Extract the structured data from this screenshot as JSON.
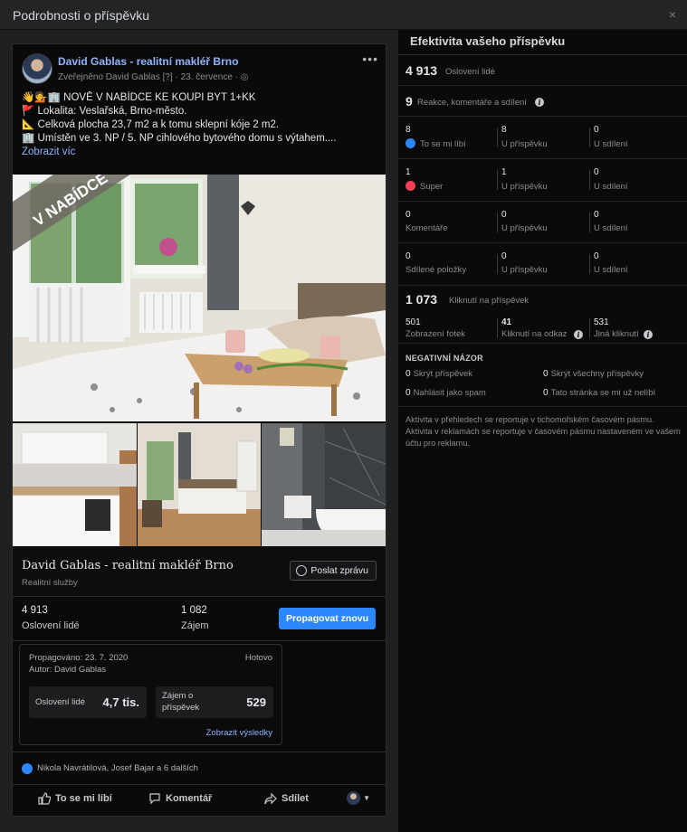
{
  "dialog": {
    "title": "Podrobnosti o příspěvku",
    "close_glyph": "×"
  },
  "post": {
    "page_name": "David Gablas - realitní makléř Brno",
    "meta": "Zveřejněno David Gablas [?] · 23. července · ◎",
    "more_glyph": "•••",
    "text_lines": [
      "👋💁🏢 NOVĚ V NABÍDCE KE KOUPI BYT 1+KK",
      "🚩 Lokalita: Veslařská, Brno-město.",
      "📐 Celková plocha 23,7 m2 a k tomu sklepní kóje 2 m2.",
      "🏢 Umístěn ve 3. NP / 5. NP cihlového bytového domu s výtahem...."
    ],
    "see_more": "Zobrazit víc",
    "banner": "V NABÍDCE",
    "footer_name": "David Gablas - realitní makléř Brno",
    "footer_category": "Realitní služby",
    "message_button": "Poslat zprávu"
  },
  "stats": {
    "reach_value": "4 913",
    "reach_label": "Oslovení lidé",
    "interest_value": "1 082",
    "interest_label": "Zájem",
    "promote_button": "Propagovat znovu"
  },
  "promo": {
    "promoted": "Propagováno: 23. 7. 2020",
    "author": "Autor: David Gablas",
    "status": "Hotovo",
    "reach_label": "Oslovení lidé",
    "reach_value": "4,7 tis.",
    "interest_label_1": "Zájem o",
    "interest_label_2": "příspěvek",
    "interest_value": "529",
    "results_link": "Zobrazit výsledky"
  },
  "reactions_summary": "Nikola Navrátilová, Josef Bajar a 6 dalších",
  "actions": {
    "like": "To se mi líbí",
    "comment": "Komentář",
    "share": "Sdílet"
  },
  "insights": {
    "header": "Efektivita vašeho příspěvku",
    "reach_value": "4 913",
    "reach_label": "Oslovení lidé",
    "engagement_value": "9",
    "engagement_label": "Reakce, komentáře a sdílení",
    "rows": [
      {
        "n1": "8",
        "l1": "To se mi líbí",
        "n2": "8",
        "l2": "U příspěvku",
        "n3": "0",
        "l3": "U sdílení"
      },
      {
        "n1": "1",
        "l1": "Super",
        "n2": "1",
        "l2": "U příspěvku",
        "n3": "0",
        "l3": "U sdílení"
      },
      {
        "n1": "0",
        "l1": "Komentáře",
        "n2": "0",
        "l2": "U příspěvku",
        "n3": "0",
        "l3": "U sdílení"
      },
      {
        "n1": "0",
        "l1": "Sdílené položky",
        "n2": "0",
        "l2": "U příspěvku",
        "n3": "0",
        "l3": "U sdílení"
      }
    ],
    "clicks_value": "1 073",
    "clicks_label": "Kliknutí na příspěvek",
    "photo_views": "501",
    "photo_views_label": "Zobrazení fotek",
    "link_clicks": "41",
    "link_clicks_label": "Kliknutí na odkaz",
    "other_clicks": "531",
    "other_clicks_label": "Jiná kliknutí",
    "negative_title": "NEGATIVNÍ NÁZOR",
    "neg_hide_post_n": "0",
    "neg_hide_post": "Skrýt příspěvek",
    "neg_hide_all_n": "0",
    "neg_hide_all": "Skrýt všechny příspěvky",
    "neg_spam_n": "0",
    "neg_spam": "Nahlásit jako spam",
    "neg_unlike_n": "0",
    "neg_unlike": "Tato stránka se mi už nelíbí",
    "footnote": "Aktivita v přehledech se reportuje v tichomořském časovém pásmu. Aktivita v reklamách se reportuje v časovém pásmu nastaveném ve vašem účtu pro reklamu."
  }
}
